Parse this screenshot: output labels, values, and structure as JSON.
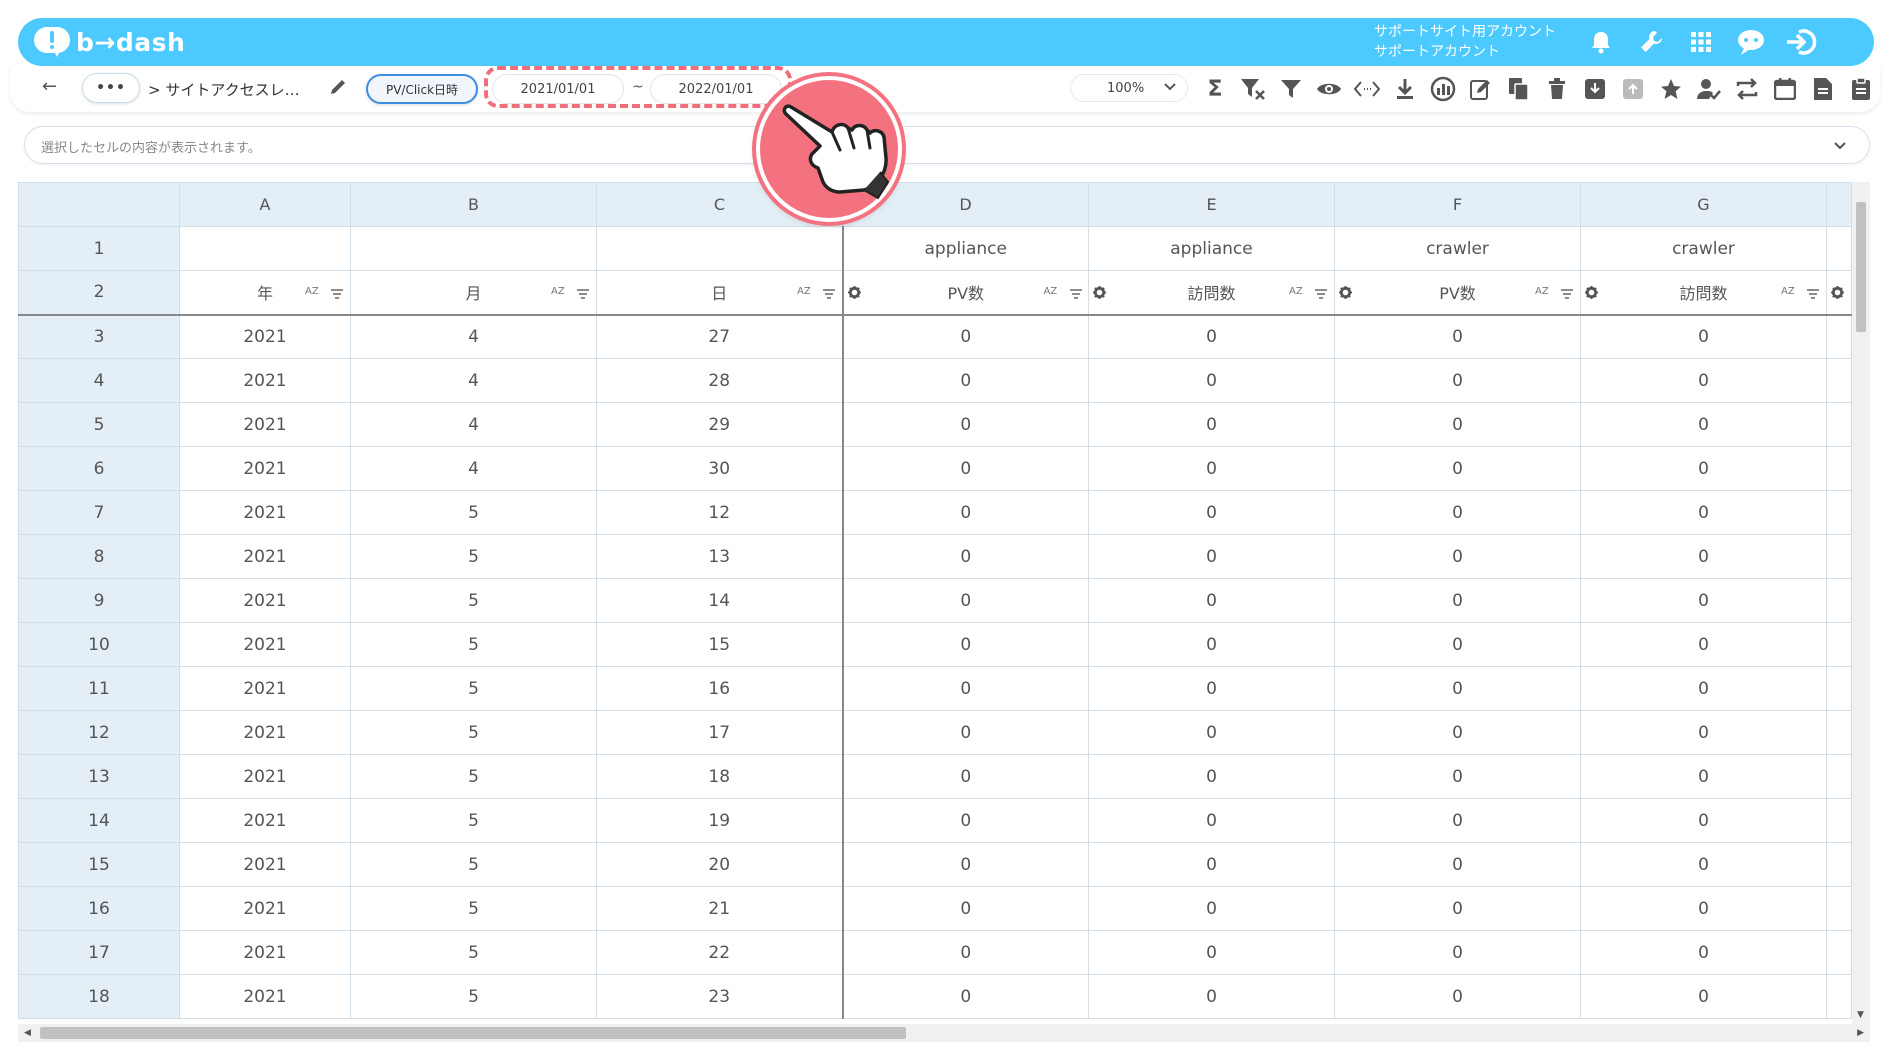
{
  "header": {
    "logo_text": "b→dash",
    "account_line1": "サポートサイト用アカウント",
    "account_line2": "サポートアカウント",
    "icons": [
      "bell-icon",
      "wrench-icon",
      "apps-grid-icon",
      "chat-bot-icon",
      "logout-icon"
    ]
  },
  "toolbar": {
    "back_icon": "←",
    "more_label": "•••",
    "breadcrumb": "> サイトアクセスレ…",
    "pv_label": "PV/Click日時",
    "date_from": "2021/01/01",
    "date_sep": "~",
    "date_to": "2022/01/01",
    "zoom": "100%",
    "icons": [
      "sum-icon",
      "filter-clear-icon",
      "filter-icon",
      "eye-icon",
      "code-icon",
      "download-icon",
      "chart-icon",
      "edit-note-icon",
      "copy-icon",
      "trash-icon",
      "archive-icon",
      "unarchive-icon",
      "star-icon",
      "user-check-icon",
      "swap-icon",
      "calendar-icon",
      "document-icon",
      "clipboard-icon"
    ]
  },
  "formula_bar": {
    "placeholder": "選択したセルの内容が表示されます。"
  },
  "sheet": {
    "columns": [
      "A",
      "B",
      "C",
      "D",
      "E",
      "F",
      "G"
    ],
    "row1": [
      "",
      "",
      "",
      "appliance",
      "appliance",
      "crawler",
      "crawler"
    ],
    "row2": [
      "年",
      "月",
      "日",
      "PV数",
      "訪問数",
      "PV数",
      "訪問数"
    ],
    "az_label": "AZ",
    "rows": [
      {
        "n": "1"
      },
      {
        "n": "2"
      },
      {
        "n": "3",
        "cells": [
          "2021",
          "4",
          "27",
          "0",
          "0",
          "0",
          "0"
        ]
      },
      {
        "n": "4",
        "cells": [
          "2021",
          "4",
          "28",
          "0",
          "0",
          "0",
          "0"
        ]
      },
      {
        "n": "5",
        "cells": [
          "2021",
          "4",
          "29",
          "0",
          "0",
          "0",
          "0"
        ]
      },
      {
        "n": "6",
        "cells": [
          "2021",
          "4",
          "30",
          "0",
          "0",
          "0",
          "0"
        ]
      },
      {
        "n": "7",
        "cells": [
          "2021",
          "5",
          "12",
          "0",
          "0",
          "0",
          "0"
        ]
      },
      {
        "n": "8",
        "cells": [
          "2021",
          "5",
          "13",
          "0",
          "0",
          "0",
          "0"
        ]
      },
      {
        "n": "9",
        "cells": [
          "2021",
          "5",
          "14",
          "0",
          "0",
          "0",
          "0"
        ]
      },
      {
        "n": "10",
        "cells": [
          "2021",
          "5",
          "15",
          "0",
          "0",
          "0",
          "0"
        ]
      },
      {
        "n": "11",
        "cells": [
          "2021",
          "5",
          "16",
          "0",
          "0",
          "0",
          "0"
        ]
      },
      {
        "n": "12",
        "cells": [
          "2021",
          "5",
          "17",
          "0",
          "0",
          "0",
          "0"
        ]
      },
      {
        "n": "13",
        "cells": [
          "2021",
          "5",
          "18",
          "0",
          "0",
          "0",
          "0"
        ]
      },
      {
        "n": "14",
        "cells": [
          "2021",
          "5",
          "19",
          "0",
          "0",
          "0",
          "0"
        ]
      },
      {
        "n": "15",
        "cells": [
          "2021",
          "5",
          "20",
          "0",
          "0",
          "0",
          "0"
        ]
      },
      {
        "n": "16",
        "cells": [
          "2021",
          "5",
          "21",
          "0",
          "0",
          "0",
          "0"
        ]
      },
      {
        "n": "17",
        "cells": [
          "2021",
          "5",
          "22",
          "0",
          "0",
          "0",
          "0"
        ]
      },
      {
        "n": "18",
        "cells": [
          "2021",
          "5",
          "23",
          "0",
          "0",
          "0",
          "0"
        ]
      }
    ]
  },
  "colors": {
    "brand": "#4ccaff",
    "highlight": "#f06e7a",
    "header_bg": "#e3eef7"
  }
}
